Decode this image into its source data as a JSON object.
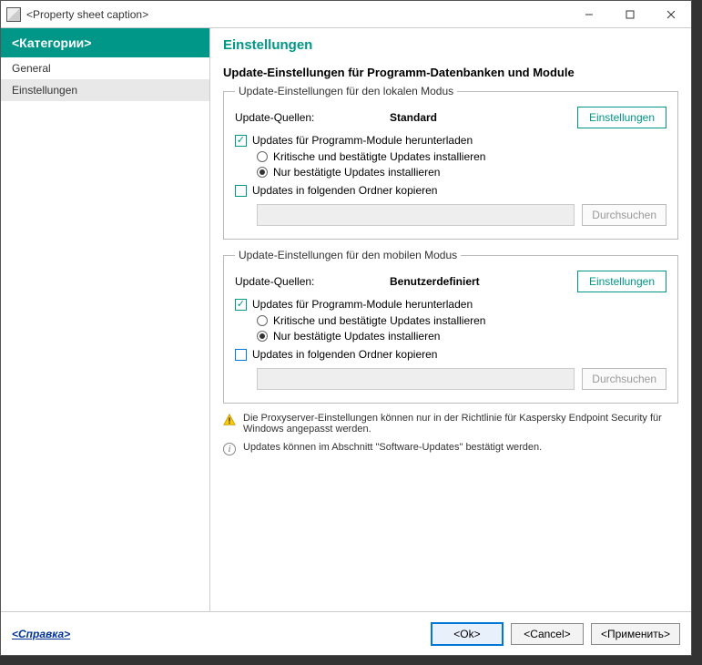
{
  "titlebar": {
    "caption": "<Property sheet caption>"
  },
  "sidebar": {
    "header": "<Категории>",
    "items": [
      {
        "label": "General"
      },
      {
        "label": "Einstellungen"
      }
    ]
  },
  "main": {
    "title": "Einstellungen",
    "section_title": "Update-Einstellungen für Programm-Datenbanken und Module",
    "local": {
      "legend": "Update-Einstellungen für den lokalen Modus",
      "sources_label": "Update-Quellen:",
      "sources_value": "Standard",
      "settings_btn": "Einstellungen",
      "download_modules": "Updates für Programm-Module herunterladen",
      "radio_critical": "Kritische und bestätigte Updates installieren",
      "radio_confirmed": "Nur bestätigte Updates installieren",
      "copy_folder": "Updates in folgenden Ordner kopieren",
      "browse": "Durchsuchen"
    },
    "mobile": {
      "legend": "Update-Einstellungen für den mobilen Modus",
      "sources_label": "Update-Quellen:",
      "sources_value": "Benutzerdefiniert",
      "settings_btn": "Einstellungen",
      "download_modules": "Updates für Programm-Module herunterladen",
      "radio_critical": "Kritische und bestätigte Updates installieren",
      "radio_confirmed": "Nur bestätigte Updates installieren",
      "copy_folder": "Updates in folgenden Ordner kopieren",
      "browse": "Durchsuchen"
    },
    "notes": {
      "proxy": "Die Proxyserver-Einstellungen können nur in der Richtlinie für Kaspersky Endpoint Security für Windows angepasst werden.",
      "info": "Updates können im Abschnitt \"Software-Updates\" bestätigt werden."
    }
  },
  "footer": {
    "help": "<Справка>",
    "ok": "<Ok>",
    "cancel": "<Cancel>",
    "apply": "<Применить>"
  }
}
